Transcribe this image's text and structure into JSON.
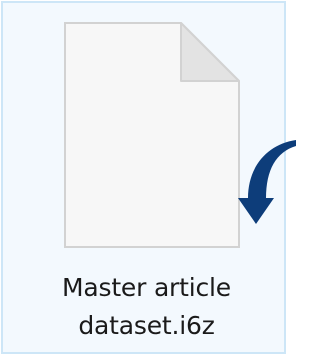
{
  "file": {
    "name_line1": "Master article",
    "name_line2": "dataset.i6z",
    "selected": true,
    "icon": "blank-document-icon"
  },
  "colors": {
    "selection_background": "#f3f9fe",
    "selection_border": "#cde6f7",
    "icon_page_fill": "#f7f7f7",
    "icon_page_border": "#d2d2d2",
    "icon_fold_fill": "#e3e3e3",
    "arrow_fill": "#0d3d7a",
    "text": "#1a1a1a"
  },
  "overlay": {
    "icon": "curved-arrow-icon"
  }
}
